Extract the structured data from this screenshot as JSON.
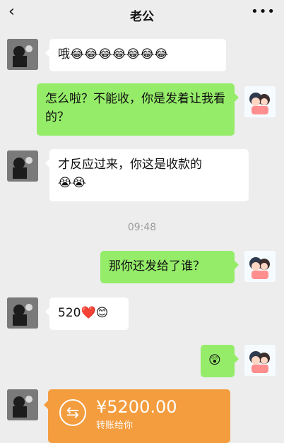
{
  "header": {
    "back_icon": "chevron-left-icon",
    "title": "老公",
    "more_icon": "more-dots-icon"
  },
  "messages": [
    {
      "side": "in",
      "text": "哦",
      "emojis": "😂😂😂😂😂😂😂"
    },
    {
      "side": "out",
      "text": "怎么啦？不能收，你是发着让我看的？"
    },
    {
      "side": "in",
      "text": "才反应过来，你这是收款的",
      "emojis": "😭😭"
    },
    {
      "side": "out",
      "text": "那你还发给了谁？"
    },
    {
      "side": "in",
      "text": "520",
      "emojis": "❤️😊"
    },
    {
      "side": "out",
      "text": "",
      "emojis": "😲"
    }
  ],
  "timestamp": "09:48",
  "transfer": {
    "amount": "¥5200.00",
    "label": "转账给你",
    "icon": "transfer-icon",
    "color": "#f39d3f"
  },
  "colors": {
    "background": "#ededed",
    "incoming_bubble": "#ffffff",
    "outgoing_bubble": "#95ec69",
    "timestamp": "#9b9b9b"
  }
}
